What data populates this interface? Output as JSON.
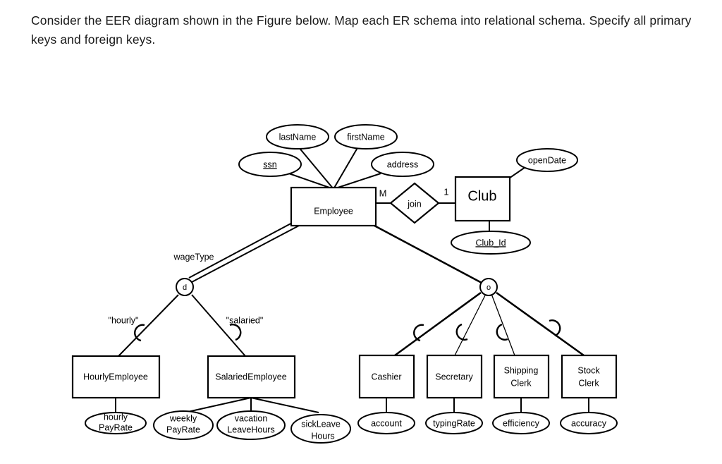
{
  "question": {
    "text": "Consider the EER diagram shown in the Figure below. Map each ER schema into relational schema. Specify all primary keys and foreign keys."
  },
  "diagram": {
    "type": "eer-diagram",
    "entities": [
      {
        "id": "employee",
        "label": "Employee",
        "kind": "strong-entity"
      },
      {
        "id": "club",
        "label": "Club",
        "kind": "strong-entity"
      },
      {
        "id": "hourly_employee",
        "label": "HourlyEmployee",
        "kind": "subclass"
      },
      {
        "id": "salaried_employee",
        "label": "SalariedEmployee",
        "kind": "subclass"
      },
      {
        "id": "cashier",
        "label": "Cashier",
        "kind": "subclass"
      },
      {
        "id": "secretary",
        "label": "Secretary",
        "kind": "subclass"
      },
      {
        "id": "shipping_clerk_line1",
        "label": "Shipping",
        "kind": "subclass"
      },
      {
        "id": "shipping_clerk_line2",
        "label": "Clerk",
        "kind": "subclass"
      },
      {
        "id": "stock_clerk_line1",
        "label": "Stock",
        "kind": "subclass"
      },
      {
        "id": "stock_clerk_line2",
        "label": "Clerk",
        "kind": "subclass"
      }
    ],
    "relationships": [
      {
        "id": "join",
        "label": "join",
        "left_cardinality": "M",
        "right_cardinality": "1"
      }
    ],
    "attributes": [
      {
        "id": "ssn",
        "label": "ssn",
        "key": true,
        "owner": "employee"
      },
      {
        "id": "last_name",
        "label": "lastName",
        "key": false,
        "owner": "employee"
      },
      {
        "id": "first_name",
        "label": "firstName",
        "key": false,
        "owner": "employee"
      },
      {
        "id": "address",
        "label": "address",
        "key": false,
        "owner": "employee"
      },
      {
        "id": "open_date",
        "label": "openDate",
        "key": false,
        "owner": "club"
      },
      {
        "id": "club_id",
        "label": "Club_Id",
        "key": true,
        "owner": "club"
      },
      {
        "id": "hourly_pay_rate_line1",
        "label": "hourly",
        "key": false,
        "owner": "hourly_employee"
      },
      {
        "id": "hourly_pay_rate_line2",
        "label": "PayRate",
        "key": false,
        "owner": "hourly_employee"
      },
      {
        "id": "weekly_pay_rate_line1",
        "label": "weekly",
        "key": false,
        "owner": "salaried_employee"
      },
      {
        "id": "weekly_pay_rate_line2",
        "label": "PayRate",
        "key": false,
        "owner": "salaried_employee"
      },
      {
        "id": "vacation_leave_hours_line1",
        "label": "vacation",
        "key": false,
        "owner": "salaried_employee"
      },
      {
        "id": "vacation_leave_hours_line2",
        "label": "LeaveHours",
        "key": false,
        "owner": "salaried_employee"
      },
      {
        "id": "sick_leave_hours_line1",
        "label": "sickLeave",
        "key": false,
        "owner": "salaried_employee"
      },
      {
        "id": "sick_leave_hours_line2",
        "label": "Hours",
        "key": false,
        "owner": "salaried_employee"
      },
      {
        "id": "account",
        "label": "account",
        "key": false,
        "owner": "cashier"
      },
      {
        "id": "typing_rate",
        "label": "typingRate",
        "key": false,
        "owner": "secretary"
      },
      {
        "id": "efficiency",
        "label": "efficiency",
        "key": false,
        "owner": "shipping_clerk"
      },
      {
        "id": "accuracy",
        "label": "accuracy",
        "key": false,
        "owner": "stock_clerk"
      }
    ],
    "specializations": [
      {
        "id": "wage_type",
        "symbol": "d",
        "discriminator": "wageType",
        "participation": "total",
        "branch_labels": [
          "\"hourly\"",
          "\"salaried\""
        ]
      },
      {
        "id": "job_type",
        "symbol": "o",
        "discriminator": "",
        "participation": "partial",
        "branch_labels": []
      }
    ]
  }
}
